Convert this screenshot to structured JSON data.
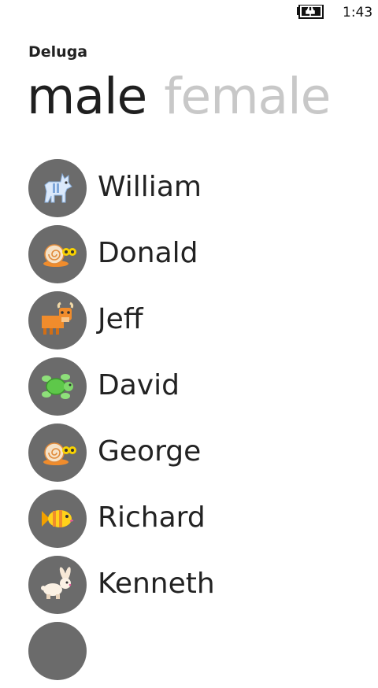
{
  "status": {
    "time": "1:43",
    "battery_icon": "battery-charging-icon"
  },
  "app": {
    "title": "Deluga"
  },
  "pivot": {
    "tabs": [
      {
        "label": "male"
      },
      {
        "label": "female"
      }
    ]
  },
  "list": {
    "items": [
      {
        "name": "William",
        "icon": "cat-icon"
      },
      {
        "name": "Donald",
        "icon": "snail-icon"
      },
      {
        "name": "Jeff",
        "icon": "bull-icon"
      },
      {
        "name": "David",
        "icon": "turtle-icon"
      },
      {
        "name": "George",
        "icon": "snail-icon"
      },
      {
        "name": "Richard",
        "icon": "fish-icon"
      },
      {
        "name": "Kenneth",
        "icon": "rabbit-icon"
      },
      {
        "name": "",
        "icon": ""
      }
    ]
  }
}
